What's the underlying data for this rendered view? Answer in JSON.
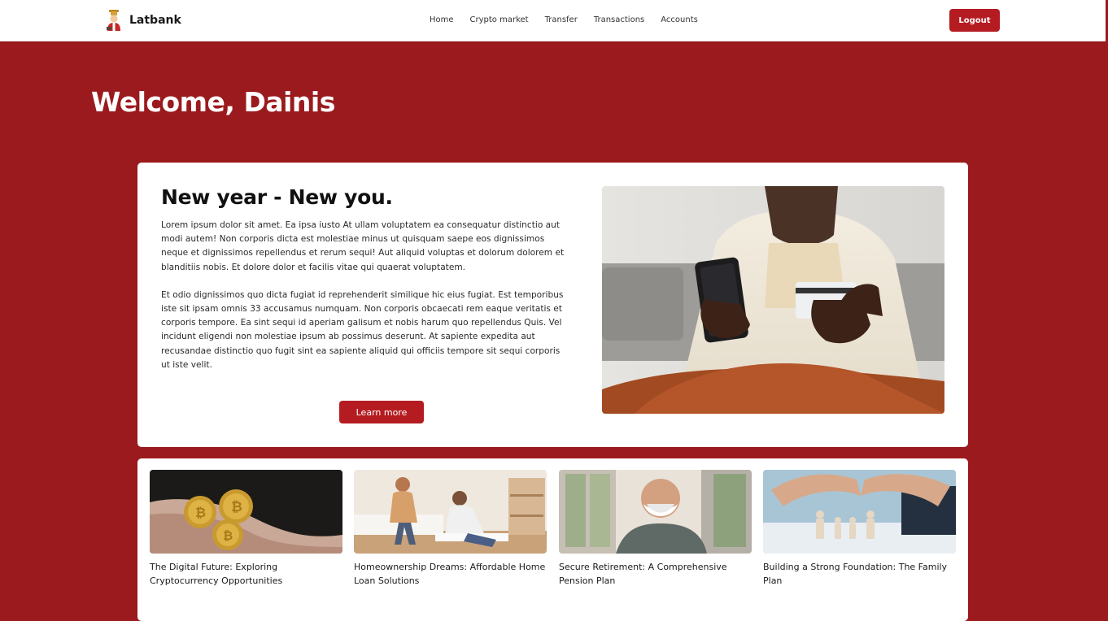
{
  "header": {
    "brand": "Latbank",
    "nav": [
      "Home",
      "Crypto market",
      "Transfer",
      "Transactions",
      "Accounts"
    ],
    "logout_label": "Logout"
  },
  "welcome": "Welcome, Dainis",
  "hero": {
    "title": "New year - New you.",
    "paragraph_1": "Lorem ipsum dolor sit amet. Ea ipsa iusto At ullam voluptatem ea consequatur distinctio aut modi autem! Non corporis dicta est molestiae minus ut quisquam saepe eos dignissimos neque et dignissimos repellendus et rerum sequi! Aut aliquid voluptas et dolorum dolorem et blanditiis nobis. Et dolore dolor et facilis vitae qui quaerat voluptatem.",
    "paragraph_2": "Et odio dignissimos quo dicta fugiat id reprehenderit similique hic eius fugiat. Est temporibus iste sit ipsam omnis 33 accusamus numquam. Non corporis obcaecati rem eaque veritatis et corporis tempore. Ea sint sequi id aperiam galisum et nobis harum quo repellendus Quis. Vel incidunt eligendi non molestiae ipsum ab possimus deserunt. At sapiente expedita aut recusandae distinctio quo fugit sint ea sapiente aliquid qui officiis tempore sit sequi corporis ut iste velit.",
    "button_label": "Learn more"
  },
  "articles": [
    {
      "title": "The Digital Future: Exploring Cryptocurrency Opportunities"
    },
    {
      "title": "Homeownership Dreams: Affordable Home Loan Solutions"
    },
    {
      "title": "Secure Retirement: A Comprehensive Pension Plan"
    },
    {
      "title": "Building a Strong Foundation: The Family Plan"
    }
  ],
  "colors": {
    "brand": "#9b1a1e",
    "button": "#b41c22"
  }
}
